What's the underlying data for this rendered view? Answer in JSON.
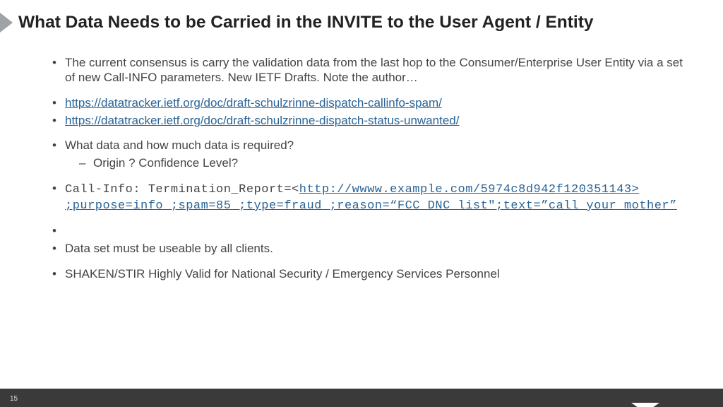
{
  "title": "What Data Needs to be Carried in the INVITE to the User Agent / Entity",
  "bullets": {
    "intro": "The current consensus is carry the validation data from the last hop to the Consumer/Enterprise User Entity via a set of new Call-INFO parameters.  New IETF Drafts.  Note the author…",
    "link1": "https://datatracker.ietf.org/doc/draft-schulzrinne-dispatch-callinfo-spam/",
    "link2": "https://datatracker.ietf.org/doc/draft-schulzrinne-dispatch-status-unwanted/",
    "q1": "What data and how much data is required?",
    "q1sub": "Origin ? Confidence Level?",
    "callinfo_lead": "Call-Info: Termination_Report=<",
    "callinfo_link": "http://wwww.example.com/5974c8d942f120351143> ;purpose=info ;spam=85 ;type=fraud ;reason=“FCC DNC list\";text=”call your mother”",
    "usable": "Data set must be useable by all clients.",
    "shaken": "SHAKEN/STIR Highly Valid for National Security / Emergency Services Personnel"
  },
  "page_number": "15"
}
